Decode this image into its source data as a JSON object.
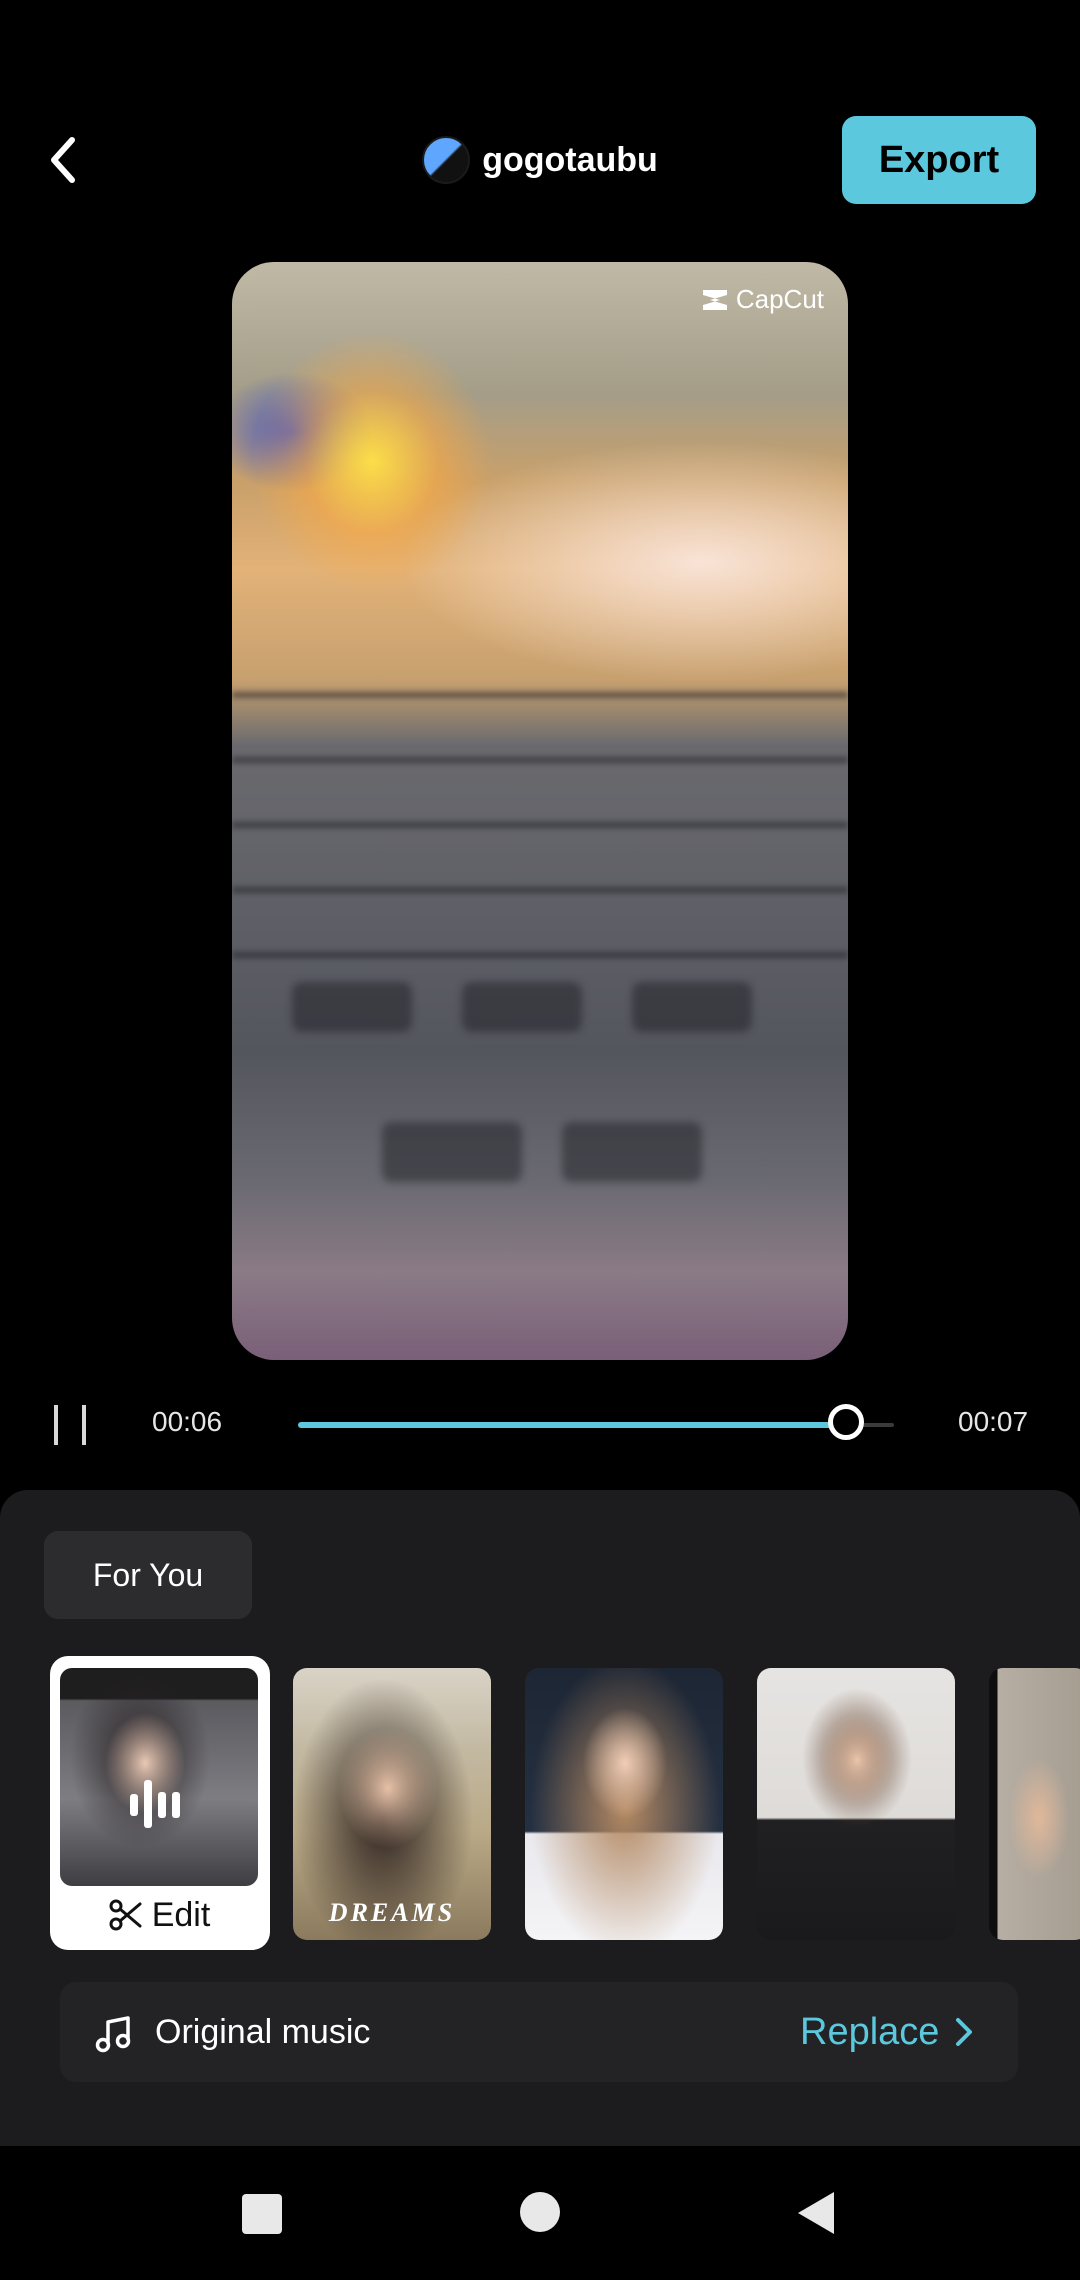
{
  "header": {
    "username": "gogotaubu",
    "export_label": "Export"
  },
  "preview": {
    "watermark": "CapCut"
  },
  "playback": {
    "current_time": "00:06",
    "total_time": "00:07",
    "progress": 0.92
  },
  "panel": {
    "tab_label": "For You",
    "templates": [
      {
        "label": "Edit",
        "selected": true
      },
      {
        "label": "DREAMS"
      },
      {
        "label": ""
      },
      {
        "label": ""
      },
      {
        "label": ""
      }
    ],
    "music": {
      "label": "Original music",
      "replace_label": "Replace"
    }
  },
  "colors": {
    "accent": "#5bc8dd",
    "panel_bg": "#1c1c1e"
  }
}
